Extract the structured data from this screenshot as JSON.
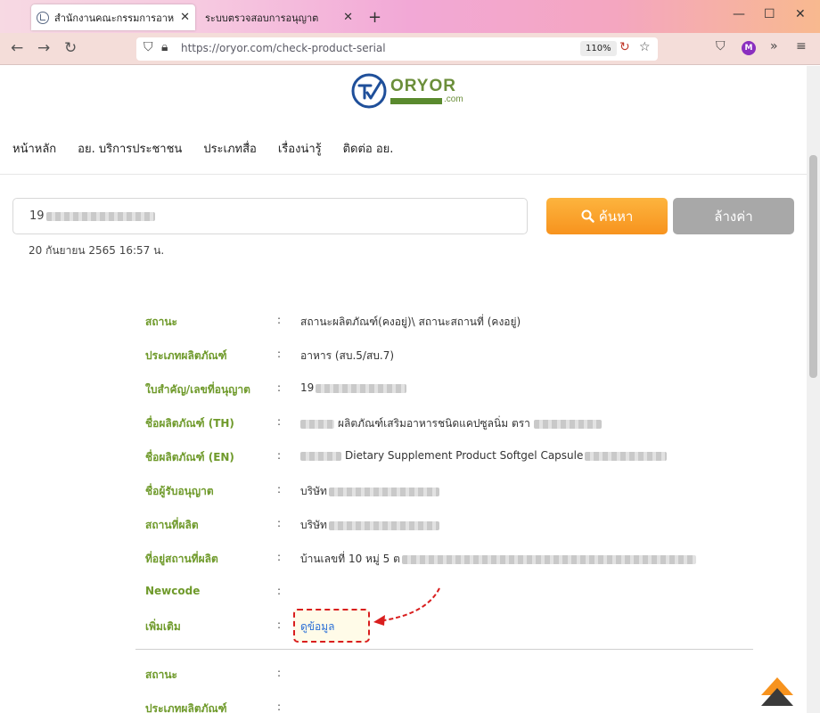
{
  "browser": {
    "tabs": [
      {
        "title": "สำนักงานคณะกรรมการอาหารและยา",
        "active": true
      },
      {
        "title": "ระบบตรวจสอบการอนุญาต",
        "active": false
      }
    ],
    "new_tab": "+",
    "window_controls": {
      "minimize": "—",
      "maximize": "☐",
      "close": "✕"
    },
    "url": "https://oryor.com/check-product-serial",
    "zoom": "110%",
    "avatar_letter": "M"
  },
  "site": {
    "logo_text": "ORYOR",
    "logo_suffix": ".com",
    "nav": [
      "หน้าหลัก",
      "อย. บริการประชาชน",
      "ประเภทสื่อ",
      "เรื่องน่ารู้",
      "ติดต่อ อย."
    ]
  },
  "search": {
    "value_prefix": "19",
    "search_label": "ค้นหา",
    "clear_label": "ล้างค่า",
    "timestamp": "20 กันยายน 2565 16:57 น."
  },
  "details": [
    {
      "label": "สถานะ",
      "value": "สถานะผลิตภัณฑ์(คงอยู่)\\ สถานะสถานที่ (คงอยู่)"
    },
    {
      "label": "ประเภทผลิตภัณฑ์",
      "value": "อาหาร (สบ.5/สบ.7)"
    },
    {
      "label": "ใบสำคัญ/เลขที่อนุญาต",
      "value": "19"
    },
    {
      "label": "ชื่อผลิตภัณฑ์ (TH)",
      "value": "ผลิตภัณฑ์เสริมอาหารชนิดแคปซูลนิ่ม ตรา"
    },
    {
      "label": "ชื่อผลิตภัณฑ์ (EN)",
      "value": "Dietary Supplement Product Softgel Capsule"
    },
    {
      "label": "ชื่อผู้รับอนุญาต",
      "value": "บริษัท"
    },
    {
      "label": "สถานที่ผลิต",
      "value": "บริษัท"
    },
    {
      "label": "ที่อยู่สถานที่ผลิต",
      "value": "บ้านเลขที่ 10 หมู่ 5 ต"
    },
    {
      "label": "Newcode",
      "value": ""
    },
    {
      "label": "เพิ่มเติม",
      "value": "ดูข้อมูล"
    }
  ],
  "details_next": [
    {
      "label": "สถานะ",
      "value": ""
    },
    {
      "label": "ประเภทผลิตภัณฑ์",
      "value": ""
    }
  ],
  "colon": ":",
  "colors": {
    "label_green": "#6f9a2b",
    "search_orange": "#f7931e",
    "clear_gray": "#a8a8a8",
    "annotation_red": "#d91e1e",
    "link_blue": "#2a6fd6"
  }
}
